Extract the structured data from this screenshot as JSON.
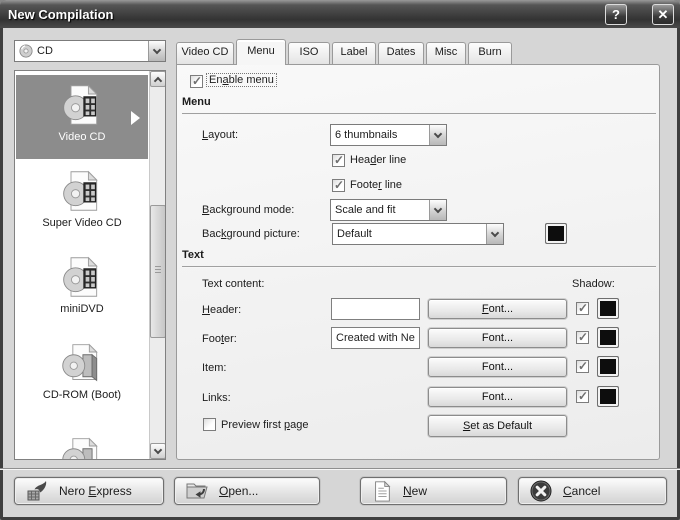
{
  "window": {
    "title": "New Compilation",
    "help": "?",
    "close": "✕"
  },
  "sidebar": {
    "media_select": {
      "value": "CD"
    },
    "items": [
      {
        "label": "Video CD",
        "selected": true
      },
      {
        "label": "Super Video CD",
        "selected": false
      },
      {
        "label": "miniDVD",
        "selected": false
      },
      {
        "label": "CD-ROM (Boot)",
        "selected": false
      },
      {
        "label": "",
        "selected": false
      }
    ]
  },
  "tabs": {
    "active": "Menu",
    "items": [
      {
        "label": "Video CD"
      },
      {
        "label": "Menu"
      },
      {
        "label": "ISO"
      },
      {
        "label": "Label"
      },
      {
        "label": "Dates"
      },
      {
        "label": "Misc"
      },
      {
        "label": "Burn"
      }
    ]
  },
  "panel": {
    "enable_menu": {
      "t": "Enable menu",
      "a": 2,
      "checked": true
    },
    "menu_group": {
      "title": "Menu",
      "layout_label": {
        "t": "Layout:",
        "a": 0
      },
      "layout_value": "6 thumbnails",
      "header_line": {
        "t": "Header line",
        "a": 3,
        "checked": true
      },
      "footer_line": {
        "t": "Footer line",
        "a": 5,
        "checked": true
      },
      "bg_mode_label": {
        "t": "Background mode:",
        "a": 0
      },
      "bg_mode_value": "Scale and fit",
      "bg_picture_label": {
        "t": "Background picture:",
        "a": 3
      },
      "bg_picture_value": "Default"
    },
    "text_group": {
      "title": "Text",
      "content_label": "Text content:",
      "shadow_label": "Shadow:",
      "header_row": {
        "label": {
          "t": "Header:",
          "a": 0
        },
        "value": "",
        "font": {
          "t": "Font...",
          "a": 0
        },
        "shadow_checked": true
      },
      "footer_row": {
        "label": {
          "t": "Footer:",
          "a": 3
        },
        "value": "Created with Ne",
        "font": {
          "t": "Font...",
          "a": -1
        },
        "shadow_checked": true
      },
      "item_row": {
        "label": {
          "t": "Item:",
          "a": -1
        },
        "font": {
          "t": "Font...",
          "a": -1
        },
        "shadow_checked": true
      },
      "links_row": {
        "label": {
          "t": "Links:",
          "a": -1
        },
        "font": {
          "t": "Font...",
          "a": -1
        },
        "shadow_checked": true
      },
      "preview": {
        "t": "Preview first page",
        "a": 14,
        "checked": false
      },
      "set_default": {
        "t": "Set as Default",
        "a": 0
      }
    }
  },
  "footer": {
    "nero_express": {
      "t": "Nero Express",
      "a": 5
    },
    "open": {
      "t": "Open...",
      "a": 0
    },
    "new": {
      "t": "New",
      "a": 0
    },
    "cancel": {
      "t": "Cancel",
      "a": 0
    }
  },
  "colors": {
    "titlebar": "#3f3f3f",
    "selection": "#8c8c8c",
    "swatch_color": "#0d0d0d",
    "dialog_bg": "#d6d6d6"
  }
}
